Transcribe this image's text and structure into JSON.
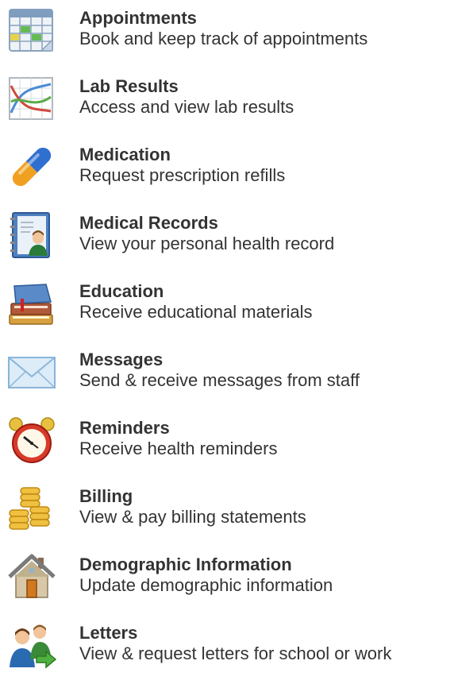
{
  "menu": {
    "items": [
      {
        "title": "Appointments",
        "description": "Book and keep track of appointments",
        "icon": "calendar-icon"
      },
      {
        "title": "Lab Results",
        "description": "Access and view lab results",
        "icon": "chart-icon"
      },
      {
        "title": "Medication",
        "description": "Request prescription refills",
        "icon": "pill-icon"
      },
      {
        "title": "Medical Records",
        "description": "View your personal health record",
        "icon": "records-icon"
      },
      {
        "title": "Education",
        "description": "Receive educational materials",
        "icon": "books-icon"
      },
      {
        "title": "Messages",
        "description": "Send & receive messages from staff",
        "icon": "envelope-icon"
      },
      {
        "title": "Reminders",
        "description": "Receive health reminders",
        "icon": "alarm-clock-icon"
      },
      {
        "title": "Billing",
        "description": "View & pay billing statements",
        "icon": "coins-icon"
      },
      {
        "title": "Demographic Information",
        "description": "Update demographic information",
        "icon": "house-icon"
      },
      {
        "title": "Letters",
        "description": "View & request letters for school or work",
        "icon": "people-letter-icon"
      }
    ]
  },
  "colors": {
    "text": "#333333",
    "background": "#ffffff"
  }
}
